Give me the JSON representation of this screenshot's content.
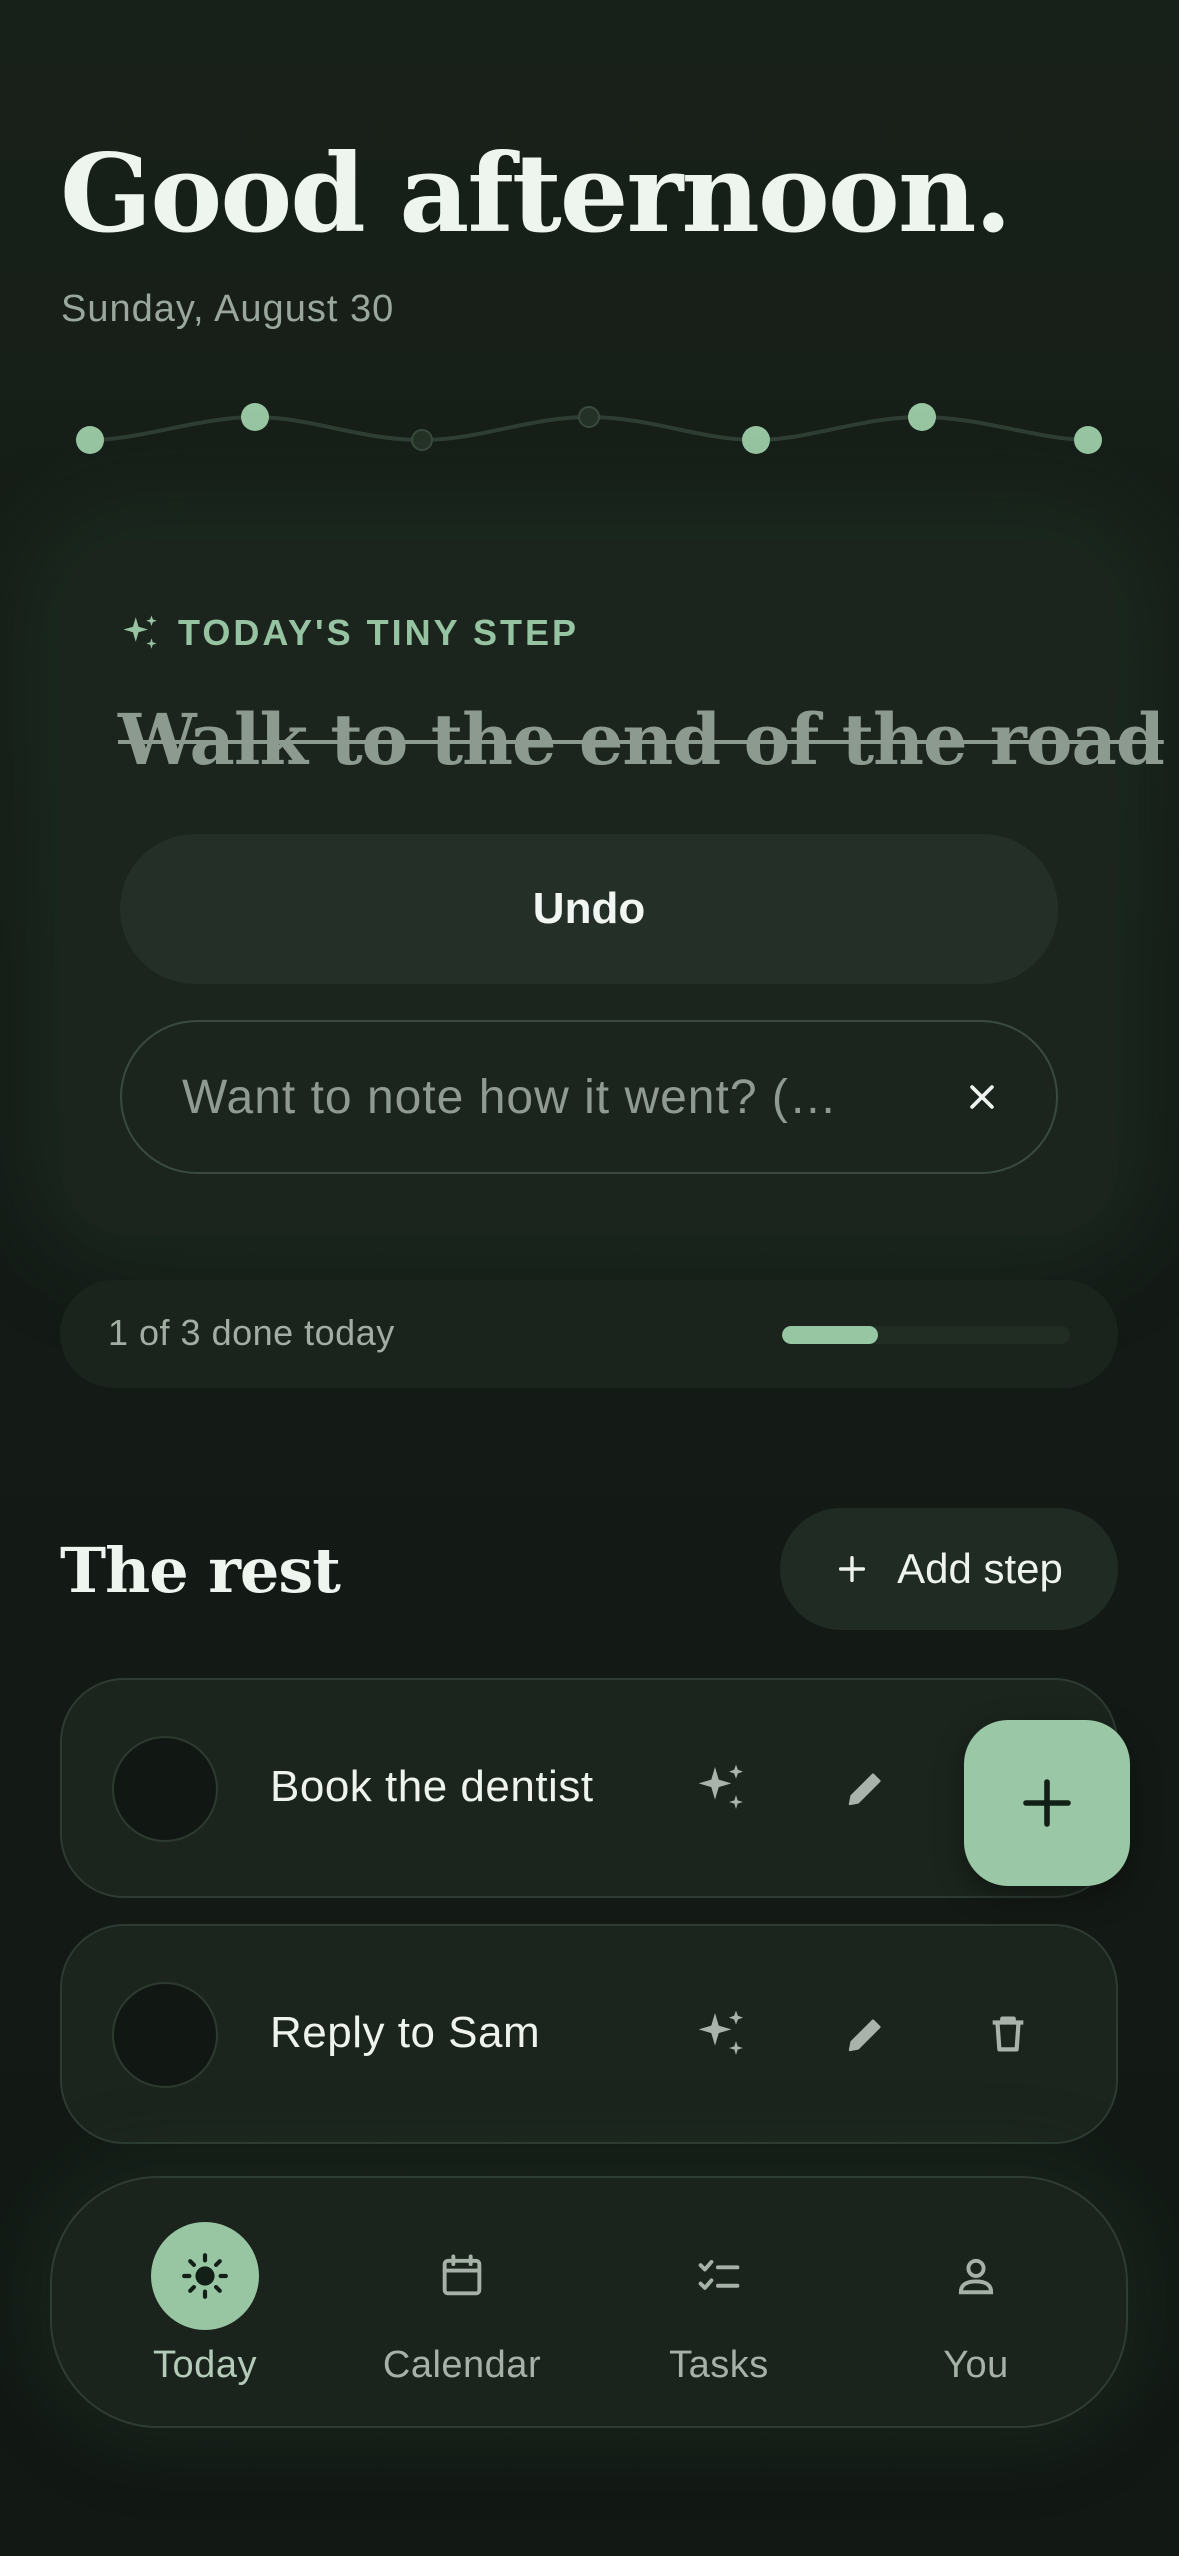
{
  "header": {
    "greeting": "Good afternoon.",
    "date": "Sunday, August 30"
  },
  "step_card": {
    "eyebrow": "TODAY'S TINY STEP",
    "title": "Walk to the end of the road",
    "undo_label": "Undo",
    "note_placeholder": "Want to note how it went? (…"
  },
  "progress": {
    "text": "1 of 3 done today",
    "done": 1,
    "total": 3
  },
  "rest": {
    "heading": "The rest",
    "add_step_label": "Add step",
    "tasks": [
      {
        "label": "Book the dentist"
      },
      {
        "label": "Reply to Sam"
      }
    ]
  },
  "nav": {
    "items": [
      {
        "label": "Today",
        "icon": "sun-icon",
        "active": true
      },
      {
        "label": "Calendar",
        "icon": "calendar-icon",
        "active": false
      },
      {
        "label": "Tasks",
        "icon": "checklist-icon",
        "active": false
      },
      {
        "label": "You",
        "icon": "user-icon",
        "active": false
      }
    ]
  },
  "colors": {
    "background": "#141b16",
    "accent": "#98c6a3",
    "card": "#1b251d",
    "text": "#eef4ee",
    "muted": "#9aa79c"
  }
}
